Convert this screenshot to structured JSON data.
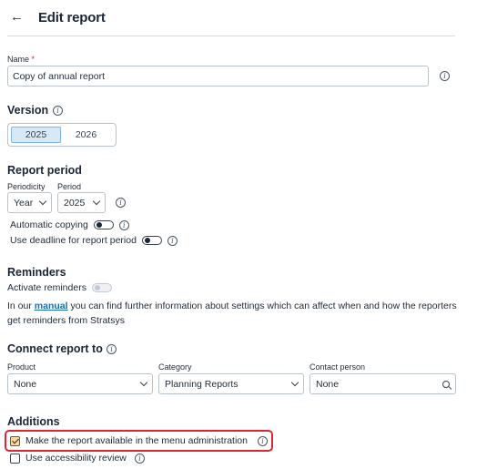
{
  "header": {
    "back_glyph": "←",
    "title": "Edit report"
  },
  "name_field": {
    "label": "Name",
    "required_mark": "*",
    "value": "Copy of annual report"
  },
  "version": {
    "title": "Version",
    "options": [
      "2025",
      "2026"
    ],
    "selected": "2025"
  },
  "report_period": {
    "title": "Report period",
    "periodicity_label": "Periodicity",
    "periodicity_value": "Year",
    "period_label": "Period",
    "period_value": "2025",
    "automatic_copying_label": "Automatic copying",
    "use_deadline_label": "Use deadline for report period"
  },
  "reminders": {
    "title": "Reminders",
    "activate_label": "Activate reminders",
    "info_prefix": "In our ",
    "info_link": "manual",
    "info_suffix": " you can find further information about settings which can affect when and how the reporters get reminders from Stratsys"
  },
  "connect": {
    "title": "Connect report to",
    "product_label": "Product",
    "product_value": "None",
    "category_label": "Category",
    "category_value": "Planning Reports",
    "contact_label": "Contact person",
    "contact_value": "None"
  },
  "additions": {
    "title": "Additions",
    "menu_admin_label": "Make the report available in the menu administration",
    "menu_admin_checked": true,
    "accessibility_label": "Use accessibility review",
    "accessibility_checked": false
  },
  "colors": {
    "highlight": "#d9282f",
    "selected_segment": "#d7e9f7",
    "checkbox_checked": "#f6d9a6",
    "link": "#1a6fb0"
  }
}
